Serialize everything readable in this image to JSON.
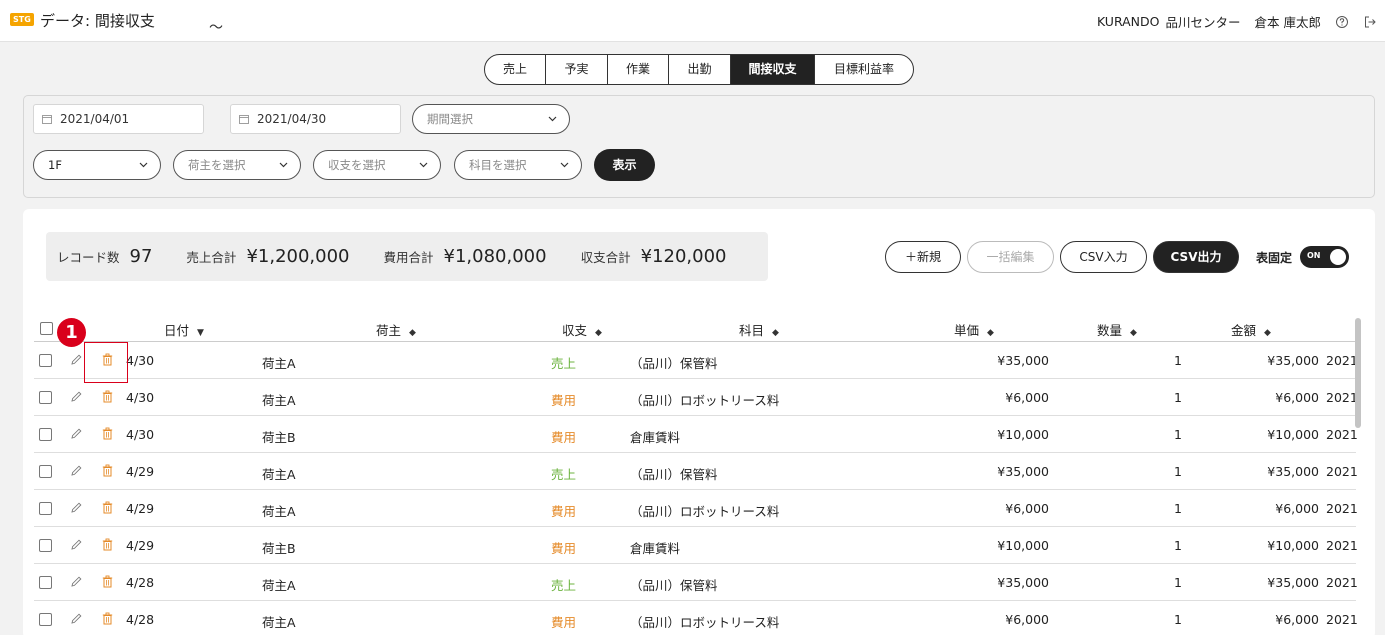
{
  "header": {
    "env_badge": "STG",
    "title": "データ: 間接収支",
    "company": "KURANDO",
    "center": "品川センター",
    "user": "倉本 庫太郎"
  },
  "tabs": [
    {
      "label": "売上",
      "active": false
    },
    {
      "label": "予実",
      "active": false
    },
    {
      "label": "作業",
      "active": false
    },
    {
      "label": "出勤",
      "active": false
    },
    {
      "label": "間接収支",
      "active": true
    },
    {
      "label": "目標利益率",
      "active": false
    }
  ],
  "filters": {
    "date_from": "2021/04/01",
    "date_to": "2021/04/30",
    "tilde": "〜",
    "period_placeholder": "期間選択",
    "floor": "1F",
    "shipper_placeholder": "荷主を選択",
    "type_placeholder": "収支を選択",
    "account_placeholder": "科目を選択",
    "show_label": "表示"
  },
  "summary": {
    "records_label": "レコード数",
    "records_value": "97",
    "sales_label": "売上合計",
    "sales_value": "¥1,200,000",
    "cost_label": "費用合計",
    "cost_value": "¥1,080,000",
    "balance_label": "収支合計",
    "balance_value": "¥120,000"
  },
  "actions": {
    "new_label": "＋新規",
    "bulk_edit_label": "一括編集",
    "csv_import_label": "CSV入力",
    "csv_export_label": "CSV出力",
    "fix_header_label": "表固定",
    "toggle_label": "ON"
  },
  "table": {
    "headers": {
      "date": "日付",
      "shipper": "荷主",
      "type": "収支",
      "account": "科目",
      "unit_price": "単価",
      "quantity": "数量",
      "amount": "金額"
    },
    "rows": [
      {
        "date": "4/30",
        "shipper": "荷主A",
        "type": "売上",
        "kind": "income",
        "account": "（品川）保管料",
        "unit_price": "¥35,000",
        "quantity": "1",
        "amount": "¥35,000",
        "extra": "2021"
      },
      {
        "date": "4/30",
        "shipper": "荷主A",
        "type": "費用",
        "kind": "expense",
        "account": "（品川）ロボットリース料",
        "unit_price": "¥6,000",
        "quantity": "1",
        "amount": "¥6,000",
        "extra": "2021"
      },
      {
        "date": "4/30",
        "shipper": "荷主B",
        "type": "費用",
        "kind": "expense",
        "account": "倉庫賃料",
        "unit_price": "¥10,000",
        "quantity": "1",
        "amount": "¥10,000",
        "extra": "2021"
      },
      {
        "date": "4/29",
        "shipper": "荷主A",
        "type": "売上",
        "kind": "income",
        "account": "（品川）保管料",
        "unit_price": "¥35,000",
        "quantity": "1",
        "amount": "¥35,000",
        "extra": "2021"
      },
      {
        "date": "4/29",
        "shipper": "荷主A",
        "type": "費用",
        "kind": "expense",
        "account": "（品川）ロボットリース料",
        "unit_price": "¥6,000",
        "quantity": "1",
        "amount": "¥6,000",
        "extra": "2021"
      },
      {
        "date": "4/29",
        "shipper": "荷主B",
        "type": "費用",
        "kind": "expense",
        "account": "倉庫賃料",
        "unit_price": "¥10,000",
        "quantity": "1",
        "amount": "¥10,000",
        "extra": "2021"
      },
      {
        "date": "4/28",
        "shipper": "荷主A",
        "type": "売上",
        "kind": "income",
        "account": "（品川）保管料",
        "unit_price": "¥35,000",
        "quantity": "1",
        "amount": "¥35,000",
        "extra": "2021"
      },
      {
        "date": "4/28",
        "shipper": "荷主A",
        "type": "費用",
        "kind": "expense",
        "account": "（品川）ロボットリース料",
        "unit_price": "¥6,000",
        "quantity": "1",
        "amount": "¥6,000",
        "extra": "2021"
      }
    ]
  },
  "annotation": {
    "number": "1"
  },
  "colors": {
    "income": "#6cb33f",
    "expense": "#e58b2a",
    "accent": "#d9001b",
    "dark": "#222222"
  }
}
